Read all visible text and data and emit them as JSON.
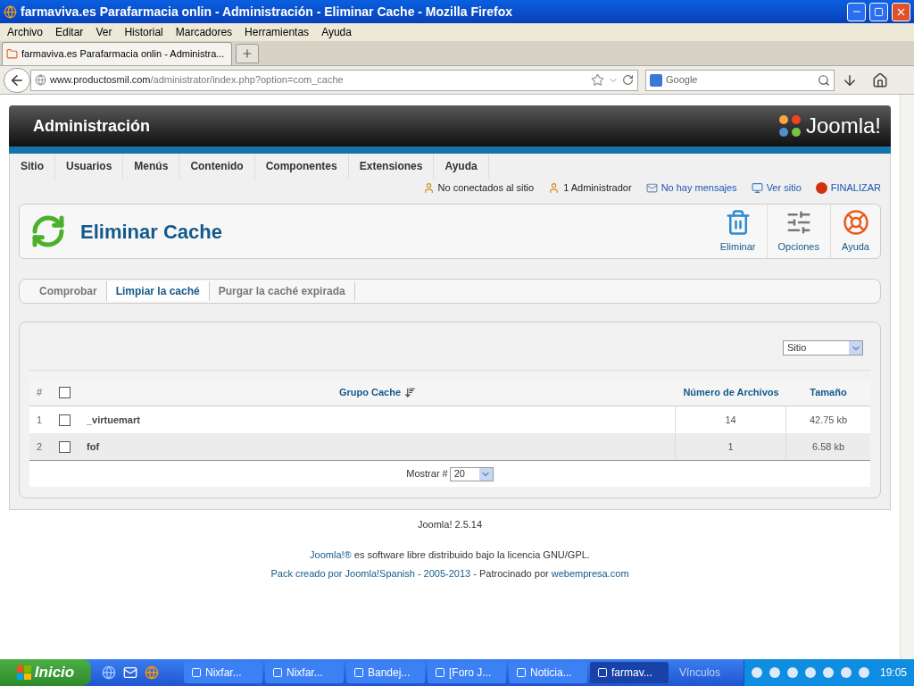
{
  "window": {
    "title": "farmaviva.es Parafarmacia onlin - Administración - Eliminar Cache - Mozilla Firefox"
  },
  "menu_bar": [
    "Archivo",
    "Editar",
    "Ver",
    "Historial",
    "Marcadores",
    "Herramientas",
    "Ayuda"
  ],
  "browser_tabs": [
    {
      "label": "farmaviva.es Parafarmacia onlin - Administra...",
      "selected": true
    }
  ],
  "address_bar": {
    "host": "www.productosmil.com",
    "path": "/administrator/index.php?option=com_cache"
  },
  "search": {
    "placeholder": "Google"
  },
  "admin": {
    "title": "Administración",
    "logo_text": "Joomla!",
    "menu": [
      "Sitio",
      "Usuarios",
      "Menús",
      "Contenido",
      "Componentes",
      "Extensiones",
      "Ayuda"
    ],
    "status": [
      {
        "kind": "text",
        "label": "No conectados al sitio"
      },
      {
        "kind": "text",
        "label": "1 Administrador"
      },
      {
        "kind": "link",
        "label": "No hay mensajes"
      },
      {
        "kind": "link",
        "label": "Ver sitio"
      },
      {
        "kind": "logout",
        "label": "FINALIZAR"
      }
    ],
    "page_title": "Eliminar Cache",
    "toolbar": [
      {
        "kind": "delete",
        "label": "Eliminar"
      },
      {
        "kind": "options",
        "label": "Opciones"
      },
      {
        "kind": "help",
        "label": "Ayuda"
      }
    ],
    "subtabs": [
      {
        "label": "Comprobar",
        "selected": false
      },
      {
        "label": "Limpiar la caché",
        "selected": true
      },
      {
        "label": "Purgar la caché expirada",
        "selected": false
      }
    ],
    "filter": {
      "value": "Sitio"
    },
    "table": {
      "columns": [
        "#",
        "Grupo Cache",
        "Número de Archivos",
        "Tamaño"
      ],
      "select_all": {
        "checked": false
      },
      "rows": [
        {
          "num": "1",
          "name": "_virtuemart",
          "files": "14",
          "size": "42.75 kb",
          "checked": false
        },
        {
          "num": "2",
          "name": "fof",
          "files": "1",
          "size": "6.58 kb",
          "checked": false
        }
      ]
    },
    "pagination": {
      "label": "Mostrar #",
      "value": "20"
    },
    "footer": {
      "version": "Joomla! 2.5.14",
      "license": [
        {
          "text": "Joomla!®",
          "link": true
        },
        {
          "text": " es software libre distribuido bajo la licencia GNU/GPL.",
          "link": false
        }
      ],
      "credits": [
        {
          "text": "Pack creado por Joomla!Spanish - 2005-2013",
          "link": true
        },
        {
          "text": " - Patrocinado por ",
          "link": false
        },
        {
          "text": "webempresa.com",
          "link": true
        }
      ]
    }
  },
  "taskbar": {
    "start": "Inicio",
    "tasks": [
      {
        "label": "Nixfar...",
        "selected": false
      },
      {
        "label": "Nixfar...",
        "selected": false
      },
      {
        "label": "Bandej...",
        "selected": false
      },
      {
        "label": "[Foro J...",
        "selected": false
      },
      {
        "label": "Noticia...",
        "selected": false
      },
      {
        "label": "farmav...",
        "selected": true
      }
    ],
    "links": "Vínculos",
    "clock": "19:05"
  }
}
